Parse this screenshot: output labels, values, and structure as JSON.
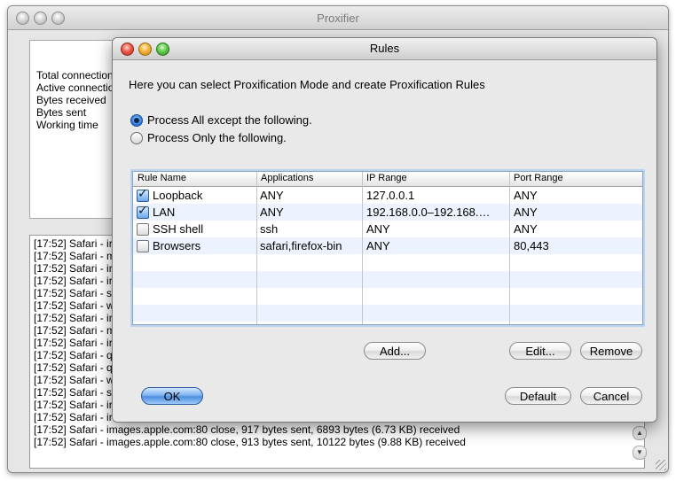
{
  "main_window": {
    "title": "Proxifier",
    "stats": [
      "Total connection",
      "Active connectio",
      "Bytes received",
      "Bytes sent",
      "Working time"
    ],
    "log_lines": [
      "[17:52] Safari - ir",
      "[17:52] Safari - m",
      "[17:52] Safari - ir",
      "[17:52] Safari - ir",
      "[17:52] Safari - st",
      "[17:52] Safari - w",
      "[17:52] Safari - ir",
      "[17:52] Safari - m",
      "[17:52] Safari - ir",
      "[17:52] Safari - q",
      "[17:52] Safari - q",
      "[17:52] Safari - w",
      "[17:52] Safari - st",
      "[17:52] Safari - ir",
      "[17:52] Safari - ir",
      "[17:52] Safari - images.apple.com:80 close, 917 bytes sent, 6893 bytes (6.73 KB) received",
      "[17:52] Safari - images.apple.com:80 close, 913 bytes sent, 10122 bytes (9.88 KB) received"
    ]
  },
  "rules": {
    "title": "Rules",
    "header": "Here you can select Proxification Mode and create Proxification Rules",
    "modes": [
      {
        "label": "Process All except the following.",
        "selected": true
      },
      {
        "label": "Process Only the following.",
        "selected": false
      }
    ],
    "columns": [
      "Rule Name",
      "Applications",
      "IP Range",
      "Port Range"
    ],
    "rows": [
      {
        "checked": true,
        "name": "Loopback",
        "apps": "ANY",
        "ip": "127.0.0.1",
        "port": "ANY"
      },
      {
        "checked": true,
        "name": "LAN",
        "apps": "ANY",
        "ip": "192.168.0.0–192.168.…",
        "port": "ANY"
      },
      {
        "checked": false,
        "name": "SSH shell",
        "apps": "ssh",
        "ip": "ANY",
        "port": "ANY"
      },
      {
        "checked": false,
        "name": "Browsers",
        "apps": "safari,firefox-bin",
        "ip": "ANY",
        "port": "80,443"
      }
    ],
    "buttons": {
      "add": "Add...",
      "edit": "Edit...",
      "remove": "Remove",
      "ok": "OK",
      "default": "Default",
      "cancel": "Cancel"
    }
  }
}
